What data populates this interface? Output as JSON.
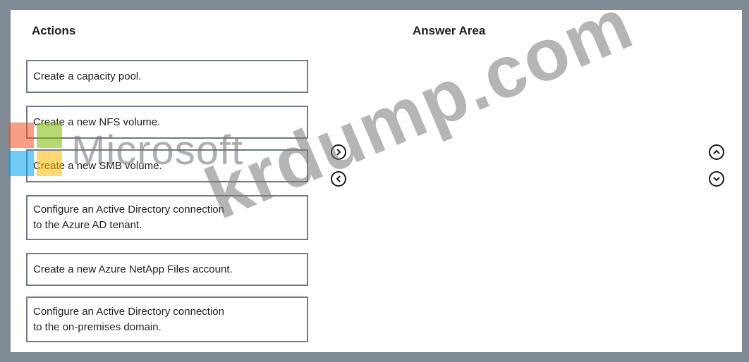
{
  "actions_heading": "Actions",
  "answer_heading": "Answer Area",
  "actions": [
    {
      "line1": "Create a capacity pool.",
      "line2": ""
    },
    {
      "line1": "Create a new NFS volume.",
      "line2": ""
    },
    {
      "line1": "Create a new SMB volume.",
      "line2": ""
    },
    {
      "line1": "Configure an Active Directory connection",
      "line2": "to the Azure AD tenant."
    },
    {
      "line1": "Create a new Azure NetApp Files account.",
      "line2": ""
    },
    {
      "line1": "Configure an Active Directory connection",
      "line2": "to the on-premises domain."
    }
  ],
  "watermark": {
    "brand": "Microsoft",
    "site": "krdump.com"
  },
  "icons": {
    "move_right": "chevron-right-circle-icon",
    "move_left": "chevron-left-circle-icon",
    "move_up": "chevron-up-circle-icon",
    "move_down": "chevron-down-circle-icon"
  },
  "colors": {
    "frame": "#7f8a95",
    "item_border": "#6f7b88"
  }
}
